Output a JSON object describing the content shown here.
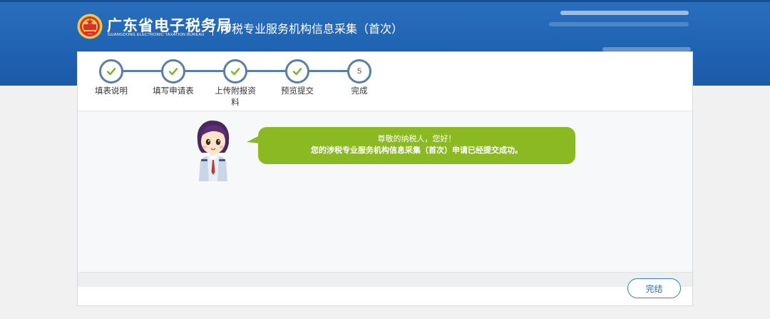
{
  "header": {
    "logo_cn": "广东省电子税务局",
    "logo_en": "GUANGDONG ELECTRONIC TAXATION BUREAU",
    "system_title": "涉税专业服务机构信息采集（首次）",
    "emblem_icon": "national-emblem-icon"
  },
  "steps": [
    {
      "label": "填表说明",
      "status": "done",
      "icon": "check-icon"
    },
    {
      "label": "填写申请表",
      "status": "done",
      "icon": "check-icon"
    },
    {
      "label": "上传附报资料",
      "status": "done",
      "icon": "check-icon"
    },
    {
      "label": "预览提交",
      "status": "done",
      "icon": "check-icon"
    },
    {
      "label": "完成",
      "status": "current",
      "number": "5"
    }
  ],
  "message": {
    "line1": "尊敬的纳税人，您好！",
    "line2": "您的涉税专业服务机构信息采集（首次）申请已经提交成功。"
  },
  "footer": {
    "finish_label": "完结"
  },
  "colors": {
    "header_blue": "#1f63b3",
    "step_border": "#5a7fa7",
    "check_green": "#7cb82f",
    "bubble_green": "#8bb922",
    "button_blue": "#3b7bbf"
  }
}
